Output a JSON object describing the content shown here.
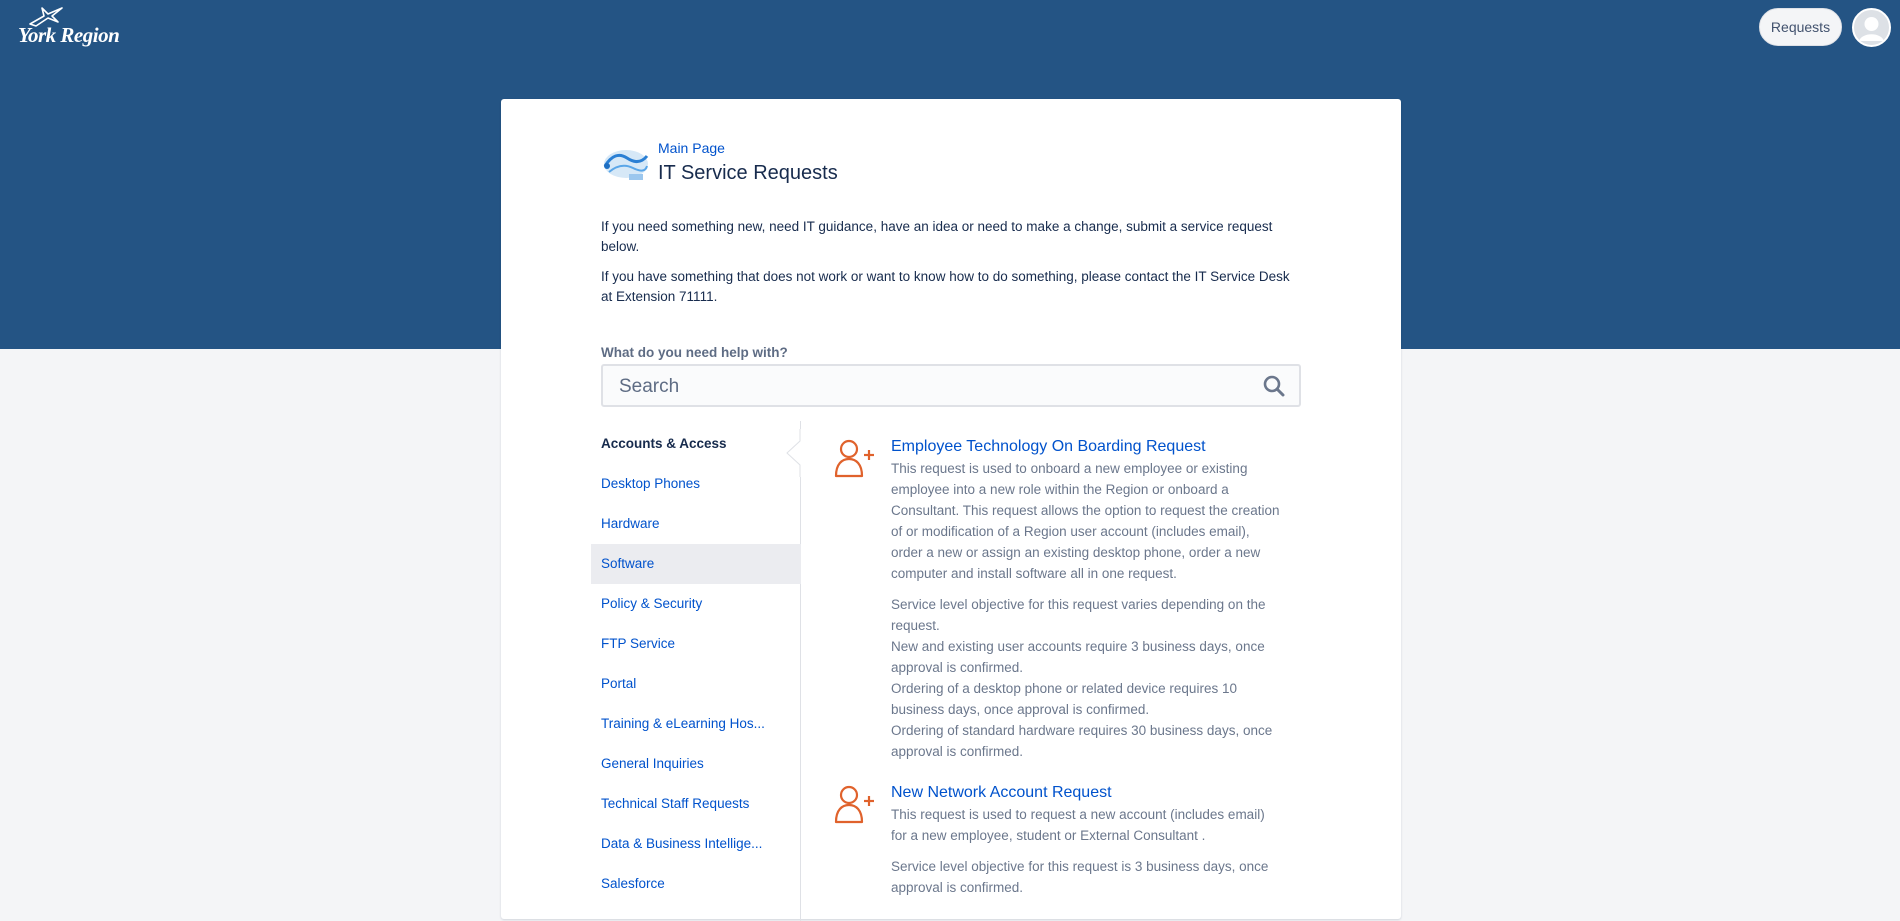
{
  "header": {
    "logo_text": "York Region",
    "requests_label": "Requests"
  },
  "portal": {
    "breadcrumb": "Main Page",
    "title": "IT Service Requests",
    "intro": [
      "If you need something new, need IT guidance, have an idea or need to make a change, submit a service request below.",
      "If you have something that does not work or want to know how to do something, please contact the IT Service Desk at Extension 71111."
    ]
  },
  "search": {
    "label": "What do you need help with?",
    "placeholder": "Search"
  },
  "sidebar": {
    "items": [
      {
        "label": "Accounts & Access",
        "state": "active"
      },
      {
        "label": "Desktop Phones",
        "state": ""
      },
      {
        "label": "Hardware",
        "state": ""
      },
      {
        "label": "Software",
        "state": "hover"
      },
      {
        "label": "Policy & Security",
        "state": ""
      },
      {
        "label": "FTP Service",
        "state": ""
      },
      {
        "label": "Portal",
        "state": ""
      },
      {
        "label": "Training & eLearning Hos...",
        "state": ""
      },
      {
        "label": "General Inquiries",
        "state": ""
      },
      {
        "label": "Technical Staff Requests",
        "state": ""
      },
      {
        "label": "Data & Business Intellige...",
        "state": ""
      },
      {
        "label": "Salesforce",
        "state": ""
      }
    ]
  },
  "requests": [
    {
      "icon": "add-user-icon",
      "title": "Employee Technology On Boarding Request",
      "description": "This request is used to onboard a new employee or existing employee into a new role within the Region or onboard a Consultant. This request allows the option to request the creation of or modification of a Region user account (includes email), order a new or assign an existing desktop phone, order a new computer and install software all in one request.",
      "sla": [
        "Service level objective for this request varies depending on the request.",
        "New and existing user accounts require 3 business days, once approval is confirmed.",
        "Ordering of a desktop phone or related device requires 10 business days, once approval is confirmed.",
        "Ordering of standard hardware requires 30 business days, once approval is confirmed."
      ]
    },
    {
      "icon": "add-user-icon",
      "title": "New Network Account Request",
      "description": "This request is used to request a new account (includes email) for a new employee, student or External Consultant .",
      "sla": [
        "Service level objective for this request is 3 business days, once approval is confirmed."
      ]
    }
  ],
  "colors": {
    "header": "#245484",
    "link": "#0052cc",
    "icon_accent": "#e0622c"
  }
}
